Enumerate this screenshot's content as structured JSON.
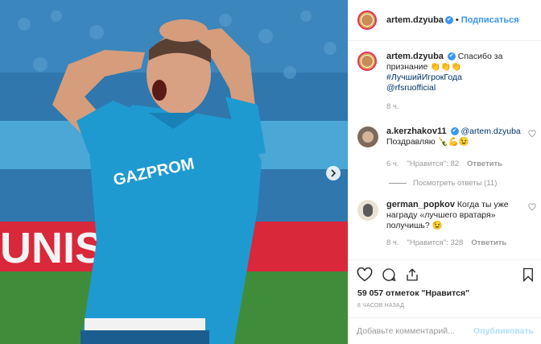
{
  "post": {
    "author": "artem.dzyuba",
    "follow_label": "Подписаться",
    "dot": "•",
    "verified_mark": "✔"
  },
  "caption": {
    "author": "artem.dzyuba",
    "text_line1": "Спасибо за",
    "text_line2": "признание 👏👏👏",
    "hashtag": "#ЛучшийИгрокГода",
    "mention": "@rfsruofficial",
    "time": "8 ч."
  },
  "comments": [
    {
      "author": "a.kerzhakov11",
      "mention": "@artem.dzyuba",
      "text": "Поздравляю 🍾💪😉",
      "time": "6 ч.",
      "likes": "\"Нравится\": 82",
      "reply": "Ответить",
      "view_replies": "Посмотреть ответы (11)"
    },
    {
      "author": "german_popkov",
      "text": "Когда ты уже награду «лучшего вратаря» получишь? 😉",
      "time": "8 ч.",
      "likes": "\"Нравится\": 328",
      "reply": "Ответить"
    }
  ],
  "stats": {
    "likes": "59 057 отметок \"Нравится\"",
    "timestamp": "8 ЧАСОВ НАЗАД"
  },
  "composer": {
    "placeholder": "Добавьте комментарий...",
    "post_label": "Опубликовать"
  },
  "photo": {
    "jersey_text": "GAZPROM",
    "banner_text": "UNISON",
    "jersey_color": "#1f9ad0",
    "pitch_color": "#3f8d3a",
    "banner_color": "#d8283a"
  }
}
